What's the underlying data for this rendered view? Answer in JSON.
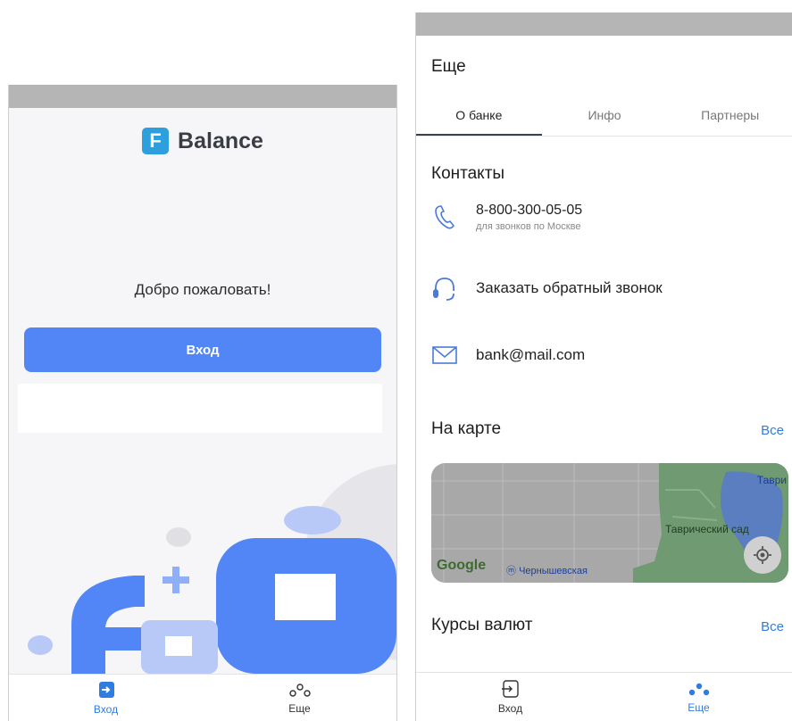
{
  "left": {
    "brand": {
      "logo_letter": "F",
      "name": "Balance"
    },
    "welcome_text": "Добро пожаловать!",
    "login_button": "Вход",
    "nav": [
      {
        "label": "Вход",
        "icon": "login-icon",
        "active": true
      },
      {
        "label": "Еще",
        "icon": "more-icon",
        "active": false
      }
    ]
  },
  "right": {
    "title": "Еще",
    "tabs": [
      "О банке",
      "Инфо",
      "Партнеры"
    ],
    "contacts": {
      "title": "Контакты",
      "phone": "8-800-300-05-05",
      "phone_note": "для звонков по Москве",
      "callback": "Заказать обратный звонок",
      "email": "bank@mail.com"
    },
    "map_section": {
      "title": "На карте",
      "all": "Все",
      "google": "Google",
      "metro": "Чернышевская",
      "park": "Таврический сад",
      "street": "Таври"
    },
    "rates": {
      "title": "Курсы валют",
      "all": "Все"
    },
    "nav": [
      {
        "label": "Вход",
        "icon": "login-icon",
        "active": false
      },
      {
        "label": "Еще",
        "icon": "more-icon",
        "active": true
      }
    ]
  },
  "colors": {
    "accent": "#5285f6",
    "link": "#2f7de1",
    "brand": "#2d9fdc"
  }
}
